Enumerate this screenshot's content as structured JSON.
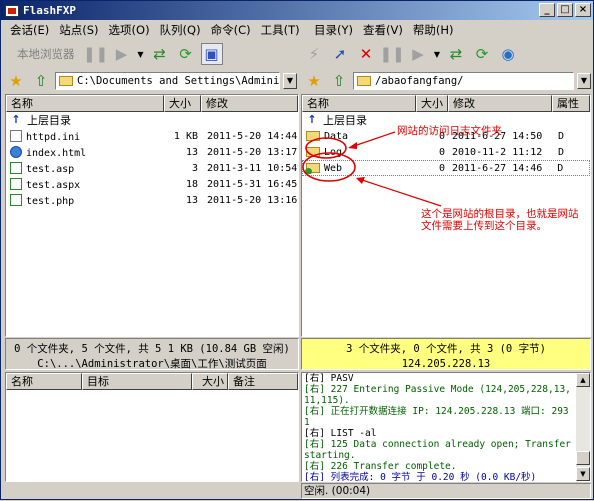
{
  "window": {
    "title": "FlashFXP",
    "buttons": {
      "minimize": "_",
      "maximize": "□",
      "close": "×"
    }
  },
  "menu": {
    "left": [
      "会话(E)",
      "站点(S)",
      "选项(O)",
      "队列(Q)",
      "命令(C)",
      "工具(T)"
    ],
    "right": [
      "目录(Y)",
      "查看(V)",
      "帮助(H)"
    ]
  },
  "toolbar_left": {
    "label": "本地浏览器"
  },
  "local_panel": {
    "path": "C:\\Documents and Settings\\Administra",
    "columns": {
      "name": "名称",
      "size": "大小",
      "modified": "修改"
    },
    "parent": "上层目录",
    "files": [
      {
        "name": "httpd.ini",
        "size": "1 KB",
        "date": "2011-5-20",
        "time": "14:44",
        "icon": "ini-file-icon"
      },
      {
        "name": "index.html",
        "size": "13",
        "date": "2011-5-20",
        "time": "13:17",
        "icon": "ie-icon"
      },
      {
        "name": "test.asp",
        "size": "3",
        "date": "2011-3-11",
        "time": "10:54",
        "icon": "asp-file-icon"
      },
      {
        "name": "test.aspx",
        "size": "18",
        "date": "2011-5-31",
        "time": "16:45",
        "icon": "asp-file-icon"
      },
      {
        "name": "test.php",
        "size": "13",
        "date": "2011-5-20",
        "time": "13:16",
        "icon": "asp-file-icon"
      }
    ],
    "status_line1": "0 个文件夹, 5 个文件, 共 5 1 KB (10.84 GB 空闲)",
    "status_line2": "C:\\...\\Administrator\\桌面\\工作\\测试页面"
  },
  "remote_panel": {
    "path": "/abaofangfang/",
    "columns": {
      "name": "名称",
      "size": "大小",
      "modified": "修改",
      "attr": "属性"
    },
    "parent": "上层目录",
    "files": [
      {
        "name": "Data",
        "size": "0",
        "date": "2011-6-27",
        "time": "14:50",
        "attr": "D",
        "icon": "folder-icon"
      },
      {
        "name": "Log",
        "size": "0",
        "date": "2010-11-2",
        "time": "11:12",
        "attr": "D",
        "icon": "folder-icon"
      },
      {
        "name": "Web",
        "size": "0",
        "date": "2011-6-27",
        "time": "14:46",
        "attr": "D",
        "icon": "web-folder-icon"
      }
    ],
    "status_line1": "3 个文件夹, 0 个文件, 共 3 (0 字节)",
    "status_line2": "124.205.228.13"
  },
  "queue": {
    "columns": {
      "name": "名称",
      "target": "目标",
      "size": "大小",
      "note": "备注"
    }
  },
  "log": [
    {
      "text": "[右] PASV",
      "style": "k"
    },
    {
      "text": "[右] 227 Entering Passive Mode (124,205,228,13,11,115).",
      "style": "g"
    },
    {
      "text": "[右] 正在打开数据连接 IP: 124.205.228.13 端口: 2931",
      "style": "g"
    },
    {
      "text": "[右] LIST -al",
      "style": "k"
    },
    {
      "text": "[右] 125 Data connection already open; Transfer starting.",
      "style": "g"
    },
    {
      "text": "[右] 226 Transfer complete.",
      "style": "g"
    },
    {
      "text": "[右] 列表完成: 0 字节 于 0.20 秒 (0.0 KB/秒)",
      "style": "b"
    }
  ],
  "bottom_status": "空闲. (00:04)",
  "annotations": {
    "access_log": "网站的访问日志文件夹",
    "root_line1": "这个是网站的根目录，也就是网站",
    "root_line2": "文件需要上传到这个目录。",
    "color": "#e00000"
  }
}
